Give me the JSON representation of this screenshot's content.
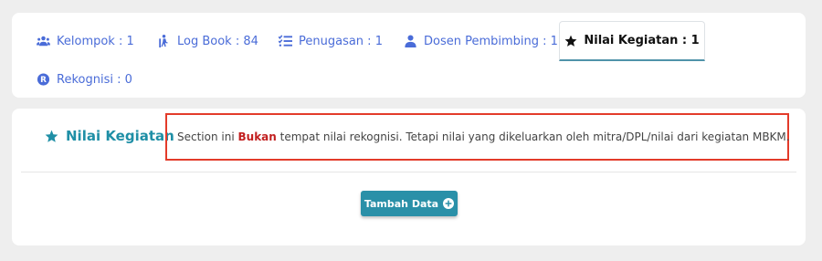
{
  "tabs": [
    {
      "label": "Kelompok : 1",
      "icon": "users-icon"
    },
    {
      "label": "Log Book : 84",
      "icon": "hiking-icon"
    },
    {
      "label": "Penugasan : 1",
      "icon": "tasks-icon"
    },
    {
      "label": "Dosen Pembimbing : 1",
      "icon": "user-tie-icon"
    },
    {
      "label": "Nilai Kegiatan : 1",
      "icon": "star-icon",
      "active": true
    },
    {
      "label": "Rekognisi : 0",
      "icon": "registered-icon"
    }
  ],
  "section": {
    "title": "Nilai Kegiatan",
    "icon": "star-icon"
  },
  "notice": {
    "before": "Section ini ",
    "highlight": "Bukan",
    "after": " tempat nilai rekognisi. Tetapi nilai yang dikeluarkan oleh mitra/DPL/nilai dari kegiatan MBKM."
  },
  "button": {
    "label": "Tambah Data",
    "icon": "plus-circle-icon"
  },
  "colors": {
    "tab_link": "#4a6cd8",
    "accent": "#1f8fa6",
    "notice_border": "#e33b2a",
    "highlight": "#c21f1f",
    "button_bg": "#2a90a8"
  }
}
